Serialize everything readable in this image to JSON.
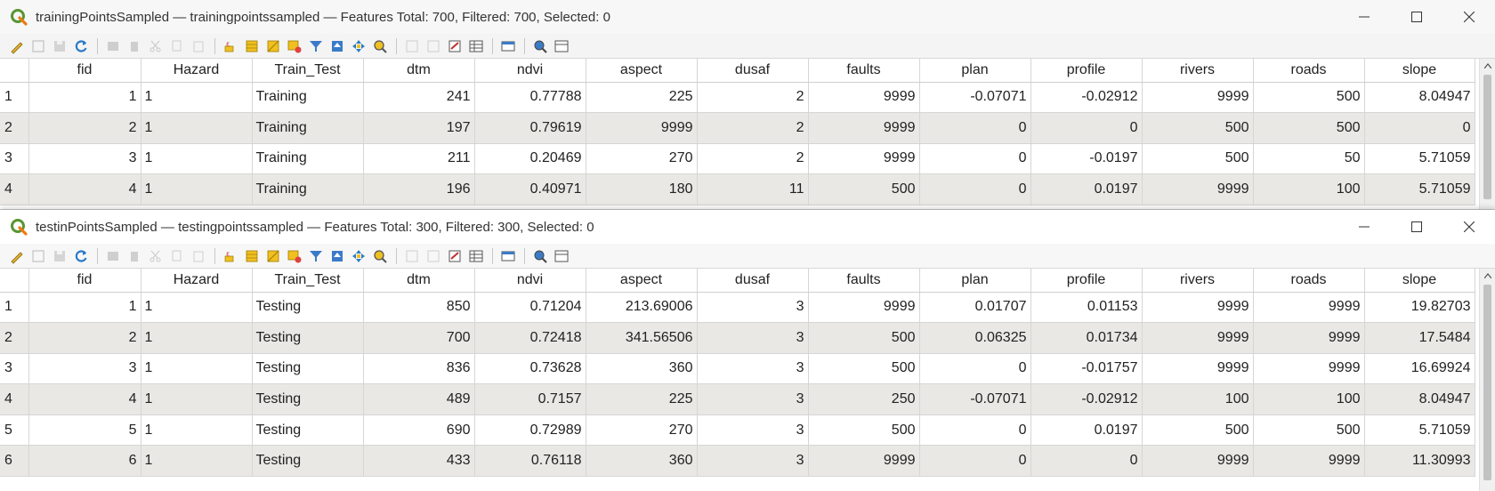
{
  "window1": {
    "title": "trainingPointsSampled — trainingpointssampled — Features Total: 700, Filtered: 700, Selected: 0",
    "columns": [
      "fid",
      "Hazard",
      "Train_Test",
      "dtm",
      "ndvi",
      "aspect",
      "dusaf",
      "faults",
      "plan",
      "profile",
      "rivers",
      "roads",
      "slope"
    ],
    "rows": [
      {
        "rownum": "1",
        "cells": [
          "1",
          "1",
          "Training",
          "241",
          "0.77788",
          "225",
          "2",
          "9999",
          "-0.07071",
          "-0.02912",
          "9999",
          "500",
          "8.04947"
        ]
      },
      {
        "rownum": "2",
        "cells": [
          "2",
          "1",
          "Training",
          "197",
          "0.79619",
          "9999",
          "2",
          "9999",
          "0",
          "0",
          "500",
          "500",
          "0"
        ]
      },
      {
        "rownum": "3",
        "cells": [
          "3",
          "1",
          "Training",
          "211",
          "0.20469",
          "270",
          "2",
          "9999",
          "0",
          "-0.0197",
          "500",
          "50",
          "5.71059"
        ]
      },
      {
        "rownum": "4",
        "cells": [
          "4",
          "1",
          "Training",
          "196",
          "0.40971",
          "180",
          "11",
          "500",
          "0",
          "0.0197",
          "9999",
          "100",
          "5.71059"
        ]
      }
    ]
  },
  "window2": {
    "title": "testinPointsSampled — testingpointssampled — Features Total: 300, Filtered: 300, Selected: 0",
    "columns": [
      "fid",
      "Hazard",
      "Train_Test",
      "dtm",
      "ndvi",
      "aspect",
      "dusaf",
      "faults",
      "plan",
      "profile",
      "rivers",
      "roads",
      "slope"
    ],
    "rows": [
      {
        "rownum": "1",
        "cells": [
          "1",
          "1",
          "Testing",
          "850",
          "0.71204",
          "213.69006",
          "3",
          "9999",
          "0.01707",
          "0.01153",
          "9999",
          "9999",
          "19.82703"
        ]
      },
      {
        "rownum": "2",
        "cells": [
          "2",
          "1",
          "Testing",
          "700",
          "0.72418",
          "341.56506",
          "3",
          "500",
          "0.06325",
          "0.01734",
          "9999",
          "9999",
          "17.5484"
        ]
      },
      {
        "rownum": "3",
        "cells": [
          "3",
          "1",
          "Testing",
          "836",
          "0.73628",
          "360",
          "3",
          "500",
          "0",
          "-0.01757",
          "9999",
          "9999",
          "16.69924"
        ]
      },
      {
        "rownum": "4",
        "cells": [
          "4",
          "1",
          "Testing",
          "489",
          "0.7157",
          "225",
          "3",
          "250",
          "-0.07071",
          "-0.02912",
          "100",
          "100",
          "8.04947"
        ]
      },
      {
        "rownum": "5",
        "cells": [
          "5",
          "1",
          "Testing",
          "690",
          "0.72989",
          "270",
          "3",
          "500",
          "0",
          "0.0197",
          "500",
          "500",
          "5.71059"
        ]
      },
      {
        "rownum": "6",
        "cells": [
          "6",
          "1",
          "Testing",
          "433",
          "0.76118",
          "360",
          "3",
          "9999",
          "0",
          "0",
          "9999",
          "9999",
          "11.30993"
        ]
      }
    ]
  },
  "toolbar_icons": [
    {
      "name": "toggle-editing-icon",
      "enabled": true
    },
    {
      "name": "toggle-multi-edit-icon",
      "enabled": false
    },
    {
      "name": "save-edits-icon",
      "enabled": false
    },
    {
      "name": "reload-icon",
      "enabled": true
    },
    {
      "sep": true
    },
    {
      "name": "add-feature-icon",
      "enabled": false
    },
    {
      "name": "delete-feature-icon",
      "enabled": false
    },
    {
      "name": "cut-icon",
      "enabled": false
    },
    {
      "name": "copy-icon",
      "enabled": false
    },
    {
      "name": "paste-icon",
      "enabled": false
    },
    {
      "sep": true
    },
    {
      "name": "select-by-expression-icon",
      "enabled": true
    },
    {
      "name": "select-all-icon",
      "enabled": true
    },
    {
      "name": "invert-selection-icon",
      "enabled": true
    },
    {
      "name": "deselect-all-icon",
      "enabled": true
    },
    {
      "name": "filter-select-icon",
      "enabled": true
    },
    {
      "name": "move-selection-to-top-icon",
      "enabled": true
    },
    {
      "name": "pan-to-selected-icon",
      "enabled": true
    },
    {
      "name": "zoom-to-selected-icon",
      "enabled": true
    },
    {
      "sep": true
    },
    {
      "name": "new-field-icon",
      "enabled": false
    },
    {
      "name": "delete-field-icon",
      "enabled": false
    },
    {
      "name": "field-calculator-icon",
      "enabled": true
    },
    {
      "name": "conditional-formatting-icon",
      "enabled": true
    },
    {
      "sep": true
    },
    {
      "name": "dock-table-icon",
      "enabled": true
    },
    {
      "sep": true
    },
    {
      "name": "actions-icon",
      "enabled": true
    },
    {
      "name": "table-view-icon",
      "enabled": true
    }
  ],
  "colors": {
    "alt_row": "#e9e8e4",
    "qgis_green": "#589632",
    "qgis_yellow": "#ee7913"
  }
}
